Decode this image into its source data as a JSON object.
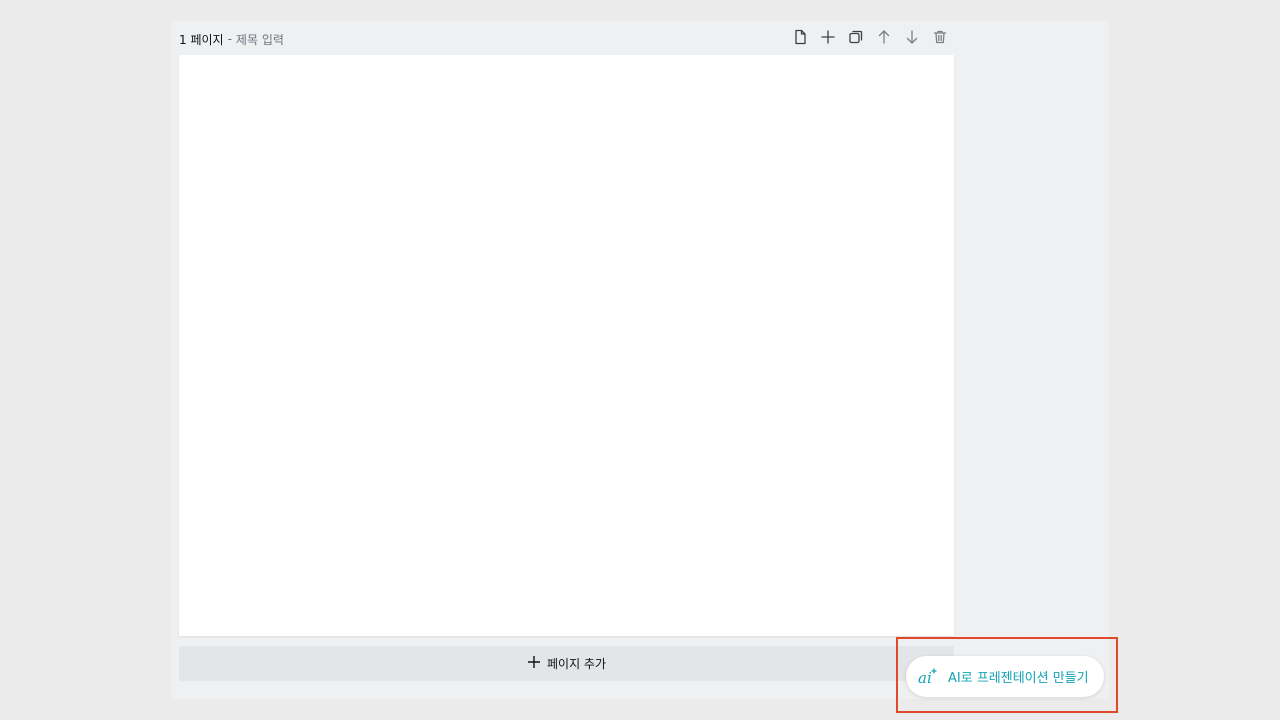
{
  "page": {
    "number_label": "1 페이지",
    "separator": "-",
    "title_placeholder": "제목 입력"
  },
  "toolbar": {
    "icons": [
      "notes-icon",
      "add-icon",
      "duplicate-icon",
      "arrow-up-icon",
      "arrow-down-icon",
      "trash-icon"
    ]
  },
  "add_page": {
    "label": "페이지 추가"
  },
  "ai_button": {
    "label": "AI로 프레젠테이션 만들기",
    "color": "#13a3b4"
  },
  "colors": {
    "highlight": "#e04a2a",
    "background": "#ebebeb",
    "canvas": "#ffffff"
  }
}
